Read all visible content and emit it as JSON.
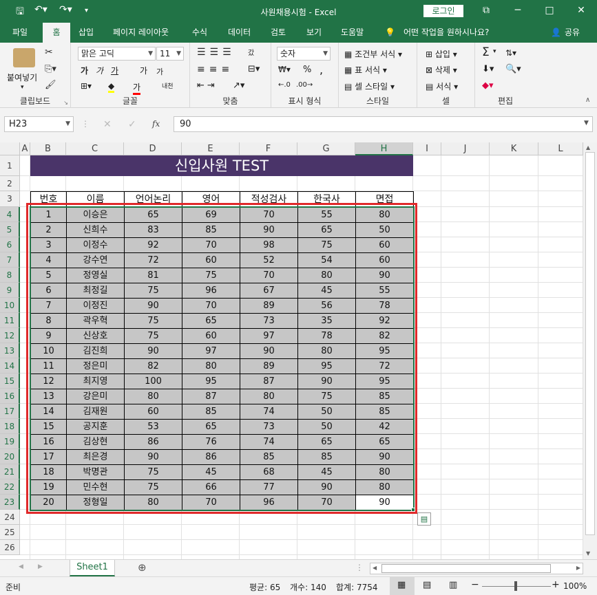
{
  "titlebar": {
    "title": "사원채용시험 - Excel",
    "login": "로그인",
    "save_icon": "save-icon",
    "undo_icon": "undo-icon",
    "redo_icon": "redo-icon",
    "minimize": "─",
    "restore": "□",
    "close": "✕",
    "ribbon_display": "⧉"
  },
  "tabs": [
    {
      "label": "파일"
    },
    {
      "label": "홈"
    },
    {
      "label": "삽입"
    },
    {
      "label": "페이지 레이아웃"
    },
    {
      "label": "수식"
    },
    {
      "label": "데이터"
    },
    {
      "label": "검토"
    },
    {
      "label": "보기"
    },
    {
      "label": "도움말"
    }
  ],
  "tell_me": "어떤 작업을 원하시나요?",
  "share": "공유",
  "ribbon": {
    "clipboard": {
      "paste": "붙여넣기",
      "label": "클립보드"
    },
    "font": {
      "name": "맑은 고딕",
      "size": "11",
      "label": "글꼴",
      "bold": "가",
      "italic": "가",
      "underline": "가",
      "grow": "가",
      "shrink": "가",
      "phonetic": "내천",
      "fill": "◆",
      "color": "가"
    },
    "align": {
      "label": "맞춤",
      "wrap": "갔"
    },
    "number": {
      "format": "숫자",
      "label": "표시 형식",
      "percent": "%",
      "comma": ","
    },
    "styles": {
      "cond": "조건부 서식",
      "table": "표 서식",
      "cell": "셀 스타일",
      "label": "스타일"
    },
    "cells": {
      "insert": "삽입",
      "delete": "삭제",
      "format": "서식",
      "label": "셀"
    },
    "edit": {
      "label": "편집",
      "sum": "Σ",
      "sort": "정렬"
    }
  },
  "formula": {
    "namebox": "H23",
    "fx": "fx",
    "value": "90"
  },
  "columns": [
    "A",
    "B",
    "C",
    "D",
    "E",
    "F",
    "G",
    "H",
    "I",
    "J",
    "K",
    "L"
  ],
  "rows": [
    "1",
    "2",
    "3",
    "4",
    "5",
    "6",
    "7",
    "8",
    "9",
    "10",
    "11",
    "12",
    "13",
    "14",
    "15",
    "16",
    "17",
    "18",
    "19",
    "20",
    "21",
    "22",
    "23",
    "24",
    "25",
    "26"
  ],
  "sheet": {
    "banner": "신입사원 TEST",
    "headers": [
      "번호",
      "이름",
      "언어논리",
      "영어",
      "적성검사",
      "한국사",
      "면접"
    ],
    "data": [
      [
        "1",
        "이승은",
        "65",
        "69",
        "70",
        "55",
        "80"
      ],
      [
        "2",
        "신희수",
        "83",
        "85",
        "90",
        "65",
        "50"
      ],
      [
        "3",
        "이정수",
        "92",
        "70",
        "98",
        "75",
        "60"
      ],
      [
        "4",
        "강수연",
        "72",
        "60",
        "52",
        "54",
        "60"
      ],
      [
        "5",
        "정영실",
        "81",
        "75",
        "70",
        "80",
        "90"
      ],
      [
        "6",
        "최정길",
        "75",
        "96",
        "67",
        "45",
        "55"
      ],
      [
        "7",
        "이정진",
        "90",
        "70",
        "89",
        "56",
        "78"
      ],
      [
        "8",
        "곽우혁",
        "75",
        "65",
        "73",
        "35",
        "92"
      ],
      [
        "9",
        "신상호",
        "75",
        "60",
        "97",
        "78",
        "82"
      ],
      [
        "10",
        "김진희",
        "90",
        "97",
        "90",
        "80",
        "95"
      ],
      [
        "11",
        "정은미",
        "82",
        "80",
        "89",
        "95",
        "72"
      ],
      [
        "12",
        "최지영",
        "100",
        "95",
        "87",
        "90",
        "95"
      ],
      [
        "13",
        "강은미",
        "80",
        "87",
        "80",
        "75",
        "85"
      ],
      [
        "14",
        "김재원",
        "60",
        "85",
        "74",
        "50",
        "85"
      ],
      [
        "15",
        "공지훈",
        "53",
        "65",
        "73",
        "50",
        "42"
      ],
      [
        "16",
        "김상현",
        "86",
        "76",
        "74",
        "65",
        "65"
      ],
      [
        "17",
        "최은경",
        "90",
        "86",
        "85",
        "85",
        "90"
      ],
      [
        "18",
        "박명관",
        "75",
        "45",
        "68",
        "45",
        "80"
      ],
      [
        "19",
        "민수현",
        "75",
        "66",
        "77",
        "90",
        "80"
      ],
      [
        "20",
        "정형일",
        "80",
        "70",
        "96",
        "70",
        "90"
      ]
    ]
  },
  "colors": {
    "excel_green": "#217346",
    "banner": "#4a3469",
    "highlight_box": "#e0292a",
    "selected_fill": "#c6c6c6"
  },
  "sheetbar": {
    "tab": "Sheet1",
    "add": "⊕"
  },
  "status": {
    "ready": "준비",
    "average": "평균: 65",
    "count": "개수: 140",
    "sum": "합계: 7754",
    "zoom": "100%"
  }
}
